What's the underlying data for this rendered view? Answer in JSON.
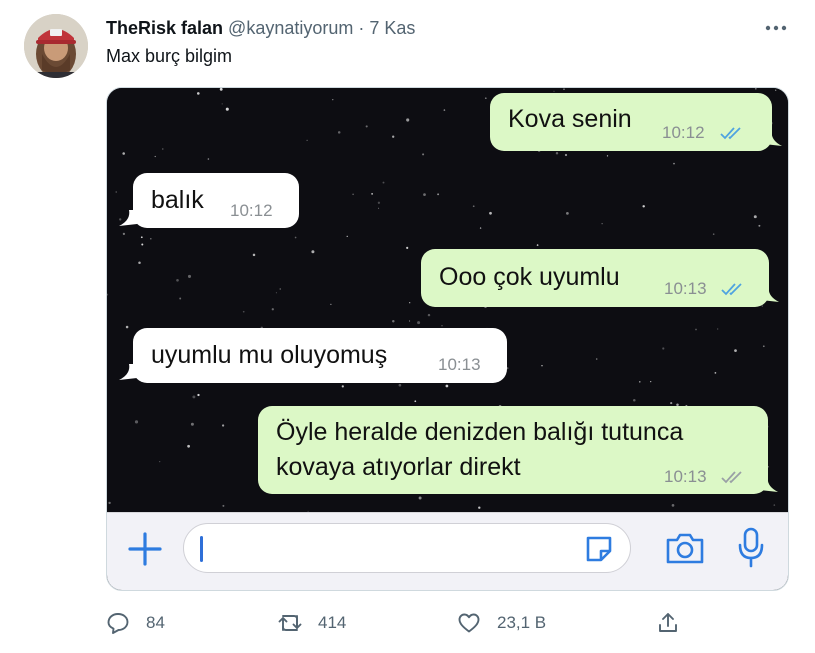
{
  "tweet": {
    "display_name": "TheRisk falan",
    "handle": "@kaynatiyorum",
    "separator": "·",
    "date": "7 Kas",
    "text": "Max burç bilgim",
    "avatar_icon": "avatar-photo",
    "more_icon": "more-horizontal-icon"
  },
  "chat": {
    "messages": [
      {
        "direction": "outgoing",
        "text": "Kova senin",
        "time": "10:12",
        "status": "read"
      },
      {
        "direction": "incoming",
        "text": "balık",
        "time": "10:12"
      },
      {
        "direction": "outgoing",
        "text": "Ooo çok uyumlu",
        "time": "10:13",
        "status": "read"
      },
      {
        "direction": "incoming",
        "text": "uyumlu mu oluyomuş",
        "time": "10:13"
      },
      {
        "direction": "outgoing",
        "text_line1": "Öyle heralde denizden balığı tutunca",
        "text_line2": "kovaya atıyorlar direkt",
        "time": "10:13",
        "status": "delivered"
      }
    ],
    "composer": {
      "input_value": "",
      "icons": [
        "plus-icon",
        "sticker-icon",
        "camera-icon",
        "microphone-icon"
      ]
    },
    "colors": {
      "background": "#0d0d12",
      "incoming_bubble": "#ffffff",
      "outgoing_bubble": "#dcf8c6",
      "read_ticks": "#4fa3e0",
      "delivered_ticks": "#9aa0a6"
    }
  },
  "actions": {
    "reply_count": "84",
    "retweet_count": "414",
    "like_count": "23,1 B",
    "icons": [
      "reply-icon",
      "retweet-icon",
      "like-icon",
      "share-icon"
    ]
  }
}
